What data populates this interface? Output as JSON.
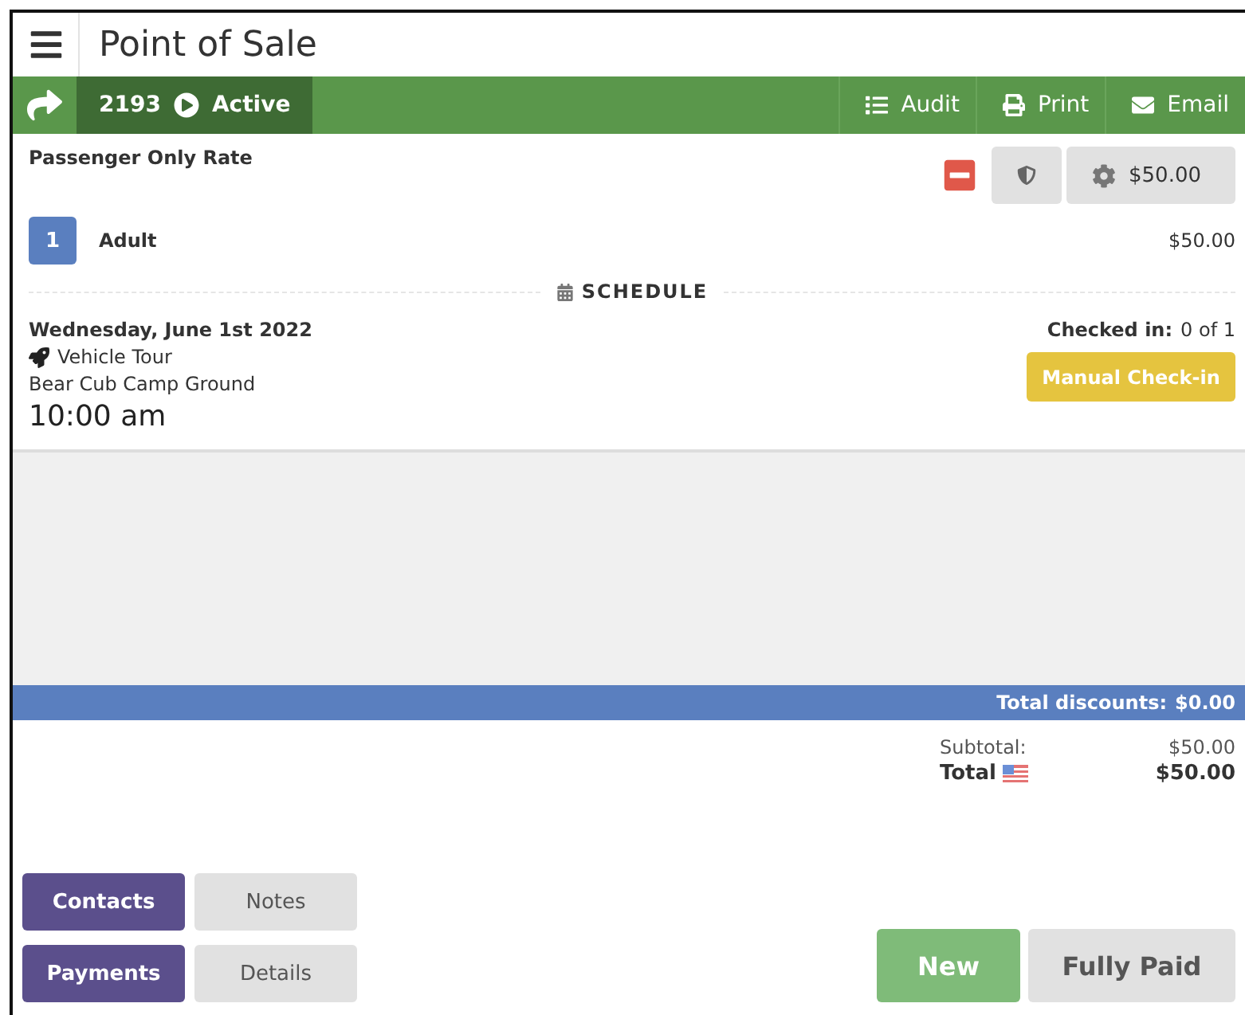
{
  "header": {
    "title": "Point of Sale"
  },
  "toolbar": {
    "order_number": "2193",
    "status": "Active",
    "actions": [
      {
        "label": "Audit",
        "kind": "list"
      },
      {
        "label": "Print",
        "kind": "print"
      },
      {
        "label": "Email",
        "kind": "mail"
      }
    ]
  },
  "line_item": {
    "name": "Passenger Only Rate",
    "price_button": "$50.00",
    "quantity": "1",
    "type": "Adult",
    "amount": "$50.00"
  },
  "schedule": {
    "heading": "SCHEDULE",
    "date": "Wednesday, June 1st 2022",
    "tour": "Vehicle Tour",
    "location": "Bear Cub Camp Ground",
    "time": "10:00 am",
    "checked_in_label": "Checked in:",
    "checked_in_value": "0 of 1",
    "check_in_button": "Manual Check-in"
  },
  "discounts": {
    "label": "Total discounts:",
    "value": "$0.00"
  },
  "totals": {
    "subtotal_label": "Subtotal:",
    "subtotal": "$50.00",
    "total_label": "Total",
    "total": "$50.00"
  },
  "panel_buttons": [
    {
      "label": "Contacts",
      "selected": true
    },
    {
      "label": "Notes",
      "selected": false
    },
    {
      "label": "Payments",
      "selected": true
    },
    {
      "label": "Details",
      "selected": false
    }
  ],
  "actions": [
    {
      "label": "New",
      "kind": "primary"
    },
    {
      "label": "Fully Paid",
      "kind": "secondary"
    }
  ]
}
